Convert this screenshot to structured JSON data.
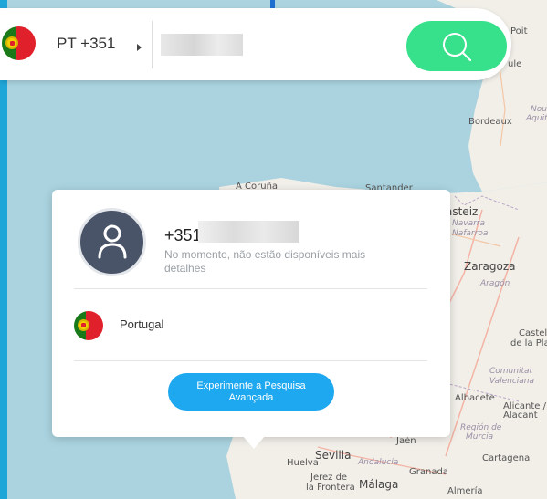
{
  "search": {
    "country_code": "PT +351",
    "phone_value": ""
  },
  "result": {
    "number_prefix": "+351",
    "description": "No momento, não estão disponíveis mais detalhes",
    "country": "Portugal",
    "advanced_button": "Experimente a Pesquisa Avançada"
  },
  "map_labels": {
    "bordeaux": "Bordeaux",
    "a_coruna": "A Coruña",
    "santander": "Santander",
    "zaragoza": "Zaragoza",
    "aragon": "Aragón",
    "navarra": "Navarra",
    "nafarroa": "Nafarroa",
    "asteiz": "asteiz",
    "albacete": "Albacete",
    "alicante": "Alicante /",
    "alacant": "Alacant",
    "comunitat": "Comunitat",
    "valenciana": "Valenciana",
    "murcia_region": "Región de",
    "murcia": "Murcia",
    "cartagena": "Cartagena",
    "sevilla": "Sevilla",
    "huelva": "Huelva",
    "andalucia": "Andalucía",
    "granada": "Granada",
    "malaga": "Málaga",
    "almeria": "Almería",
    "jerez": "Jerez de",
    "frontera": "la Frontera",
    "jaen": "Jaén",
    "castello": "Castelló",
    "de_la_plana": "de la Plan",
    "poit": "Poit",
    "nou": "Nou",
    "aquit": "Aquit",
    "ule": "ule"
  },
  "colors": {
    "search_button": "#37e08a",
    "advanced_button": "#1ea8f0",
    "avatar_bg": "#4a5468",
    "water": "#aad3df",
    "land": "#f2efe9"
  },
  "icons": {
    "search": "search-icon",
    "user": "user-icon",
    "flag": "portugal-flag-icon"
  }
}
